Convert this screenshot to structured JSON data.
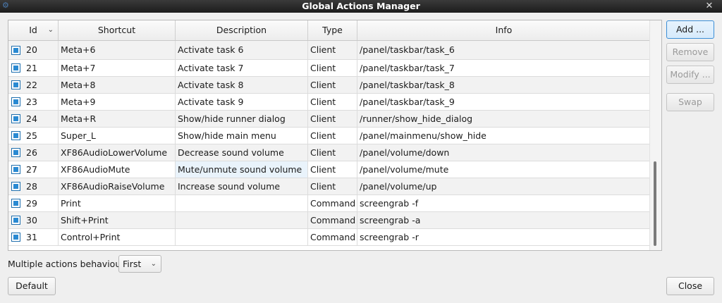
{
  "window": {
    "title": "Global Actions Manager",
    "close_glyph": "✕",
    "app_icon": "app-icon"
  },
  "table": {
    "columns": [
      "Id",
      "Shortcut",
      "Description",
      "Type",
      "Info"
    ],
    "sort_indicator": "⌄",
    "rows": [
      {
        "id": "20",
        "shortcut": "Meta+6",
        "description": "Activate task 6",
        "type": "Client",
        "info": "/panel/taskbar/task_6"
      },
      {
        "id": "21",
        "shortcut": "Meta+7",
        "description": "Activate task 7",
        "type": "Client",
        "info": "/panel/taskbar/task_7"
      },
      {
        "id": "22",
        "shortcut": "Meta+8",
        "description": "Activate task 8",
        "type": "Client",
        "info": "/panel/taskbar/task_8"
      },
      {
        "id": "23",
        "shortcut": "Meta+9",
        "description": "Activate task 9",
        "type": "Client",
        "info": "/panel/taskbar/task_9"
      },
      {
        "id": "24",
        "shortcut": "Meta+R",
        "description": "Show/hide runner dialog",
        "type": "Client",
        "info": "/runner/show_hide_dialog"
      },
      {
        "id": "25",
        "shortcut": "Super_L",
        "description": "Show/hide main menu",
        "type": "Client",
        "info": "/panel/mainmenu/show_hide"
      },
      {
        "id": "26",
        "shortcut": "XF86AudioLowerVolume",
        "description": "Decrease sound volume",
        "type": "Client",
        "info": "/panel/volume/down"
      },
      {
        "id": "27",
        "shortcut": "XF86AudioMute",
        "description": "Mute/unmute sound volume",
        "type": "Client",
        "info": "/panel/volume/mute"
      },
      {
        "id": "28",
        "shortcut": "XF86AudioRaiseVolume",
        "description": "Increase sound volume",
        "type": "Client",
        "info": "/panel/volume/up"
      },
      {
        "id": "29",
        "shortcut": "Print",
        "description": "",
        "type": "Command",
        "info": "screengrab -f"
      },
      {
        "id": "30",
        "shortcut": "Shift+Print",
        "description": "",
        "type": "Command",
        "info": "screengrab -a"
      },
      {
        "id": "31",
        "shortcut": "Control+Print",
        "description": "",
        "type": "Command",
        "info": "screengrab -r"
      }
    ]
  },
  "buttons": {
    "add": "Add ...",
    "remove": "Remove",
    "modify": "Modify ...",
    "swap": "Swap",
    "default": "Default",
    "close": "Close"
  },
  "behaviour": {
    "label": "Multiple actions behaviour:",
    "value": "First",
    "arrow": "⌄"
  },
  "colors": {
    "accent": "#2a8ad2",
    "titlebar": "#2a2a2a"
  }
}
